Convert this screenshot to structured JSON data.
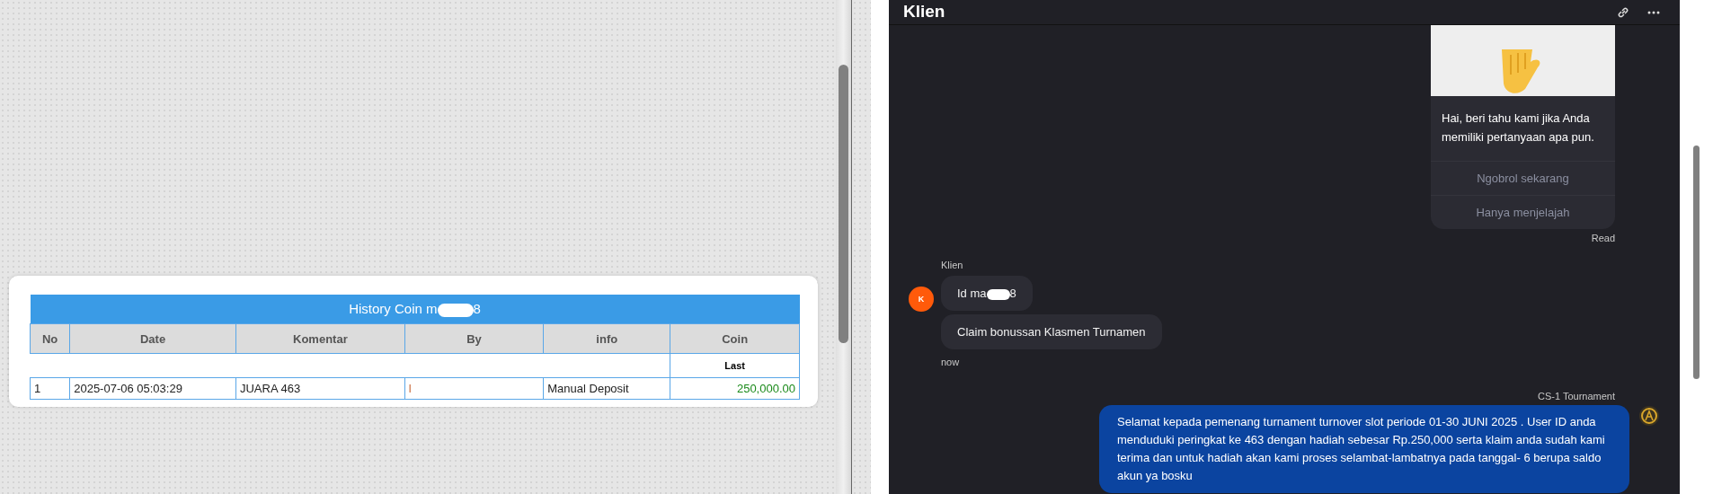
{
  "history": {
    "title_start": "History Coin m",
    "title_end": "8",
    "columns": [
      "No",
      "Date",
      "Komentar",
      "By",
      "info",
      "Coin"
    ],
    "subheader": "Last",
    "rows": [
      {
        "no": "1",
        "date": "2025-07-06 05:03:29",
        "komentar": "JUARA 463",
        "by": "l",
        "info": "Manual Deposit",
        "coin": "250,000.00"
      }
    ]
  },
  "chat": {
    "title": "Klien",
    "welcome": {
      "text": "Hai, beri tahu kami jika Anda memiliki pertanyaan apa pun.",
      "actions": [
        "Ngobrol sekarang",
        "Hanya menjelajah"
      ],
      "status": "Read"
    },
    "incoming": {
      "sender": "Klien",
      "avatar": "K",
      "messages": [
        {
          "kind": "redacted",
          "start": "Id ma",
          "end": "8"
        },
        {
          "kind": "plain",
          "text": "Claim bonussan Klasmen Turnamen"
        }
      ],
      "time": "now"
    },
    "outgoing": {
      "sender": "CS-1 Tournament",
      "text": "Selamat kepada pemenang turnament turnover slot periode 01-30 JUNI 2025 . User ID anda menduduki peringkat ke 463 dengan hadiah sebesar Rp.250,000 serta klaim anda sudah kami terima dan untuk hadiah akan kami proses selambat-lambatnya pada tanggal- 6 berupa saldo akun ya bosku"
    }
  }
}
